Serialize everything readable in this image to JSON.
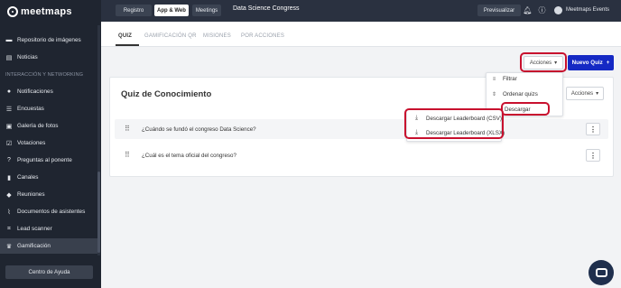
{
  "brand": {
    "name": "meetmaps"
  },
  "sidebar": {
    "items": [
      {
        "label": "Repositorio de imágenes",
        "icon": "folder-icon"
      },
      {
        "label": "Noticias",
        "icon": "newspaper-icon"
      },
      {
        "label": "Notificaciones",
        "icon": "bell-icon"
      },
      {
        "label": "Encuestas",
        "icon": "checklist-icon"
      },
      {
        "label": "Galería de fotos",
        "icon": "image-icon"
      },
      {
        "label": "Votaciones",
        "icon": "vote-icon"
      },
      {
        "label": "Preguntas al ponente",
        "icon": "question-icon"
      },
      {
        "label": "Canales",
        "icon": "document-icon"
      },
      {
        "label": "Reuniones",
        "icon": "handshake-icon"
      },
      {
        "label": "Documentos de asistentes",
        "icon": "attachment-icon"
      },
      {
        "label": "Lead scanner",
        "icon": "scanner-icon"
      },
      {
        "label": "Gamificación",
        "icon": "trophy-icon"
      }
    ],
    "section_label": "INTERACCIÓN Y NETWORKING",
    "help_label": "Centro de Ayuda"
  },
  "topbar": {
    "nav": [
      "Registro",
      "App & Web",
      "Meetings"
    ],
    "event_name": "Data Science Congress",
    "preview_label": "Previsualizar",
    "user_name": "Meetmaps Events"
  },
  "tabs": [
    "QUIZ",
    "GAMIFICACIÓN QR",
    "MISIONES",
    "POR ACCIONES"
  ],
  "actions": {
    "acciones_label": "Acciones",
    "new_quiz_label": "Nuevo Quiz",
    "menu": [
      "Filtrar",
      "Ordenar quizs",
      "Descargar"
    ],
    "download_submenu": [
      "Descargar Leaderboard (CSV)",
      "Descargar Leaderboard (XLSX)"
    ]
  },
  "card": {
    "title": "Quiz de Conocimiento",
    "acciones_label": "Acciones",
    "questions": [
      "¿Cuándo se fundó el congreso Data Science?",
      "¿Cuál es el tema oficial del congreso?"
    ]
  },
  "colors": {
    "accent": "#1529c4",
    "sidebar_bg": "#1f2530",
    "highlight": "#c8102e"
  }
}
